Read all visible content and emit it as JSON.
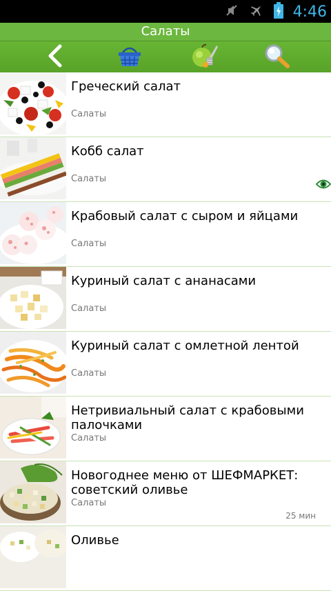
{
  "status": {
    "time": "4:46"
  },
  "header": {
    "title": "Салаты"
  },
  "toolbar": {
    "back_icon": "back-arrow-icon",
    "basket_icon": "basket-icon",
    "apple_icon": "apple-scale-icon",
    "search_icon": "search-icon"
  },
  "items": [
    {
      "title": "Греческий салат",
      "category": "Салаты",
      "time": "",
      "viewed": false,
      "thumb": "greek"
    },
    {
      "title": "Кобб салат",
      "category": "Салаты",
      "time": "",
      "viewed": true,
      "thumb": "cobb"
    },
    {
      "title": "Крабовый салат с сыром и яйцами",
      "category": "Салаты",
      "time": "",
      "viewed": false,
      "thumb": "crab"
    },
    {
      "title": "Куриный салат с ананасами",
      "category": "Салаты",
      "time": "",
      "viewed": false,
      "thumb": "chicken"
    },
    {
      "title": "Куриный салат с омлетной лентой",
      "category": "Салаты",
      "time": "",
      "viewed": false,
      "thumb": "omelet"
    },
    {
      "title": "Нетривиальный салат с крабовыми палочками",
      "category": "Салаты",
      "time": "",
      "viewed": false,
      "thumb": "sticks"
    },
    {
      "title": "Новогоднее меню от ШЕФМАРКЕТ: советский оливье",
      "category": "Салаты",
      "time": "25 мин",
      "viewed": false,
      "thumb": "olivier"
    },
    {
      "title": "Оливье",
      "category": "",
      "time": "",
      "viewed": false,
      "thumb": "olivier2"
    }
  ]
}
